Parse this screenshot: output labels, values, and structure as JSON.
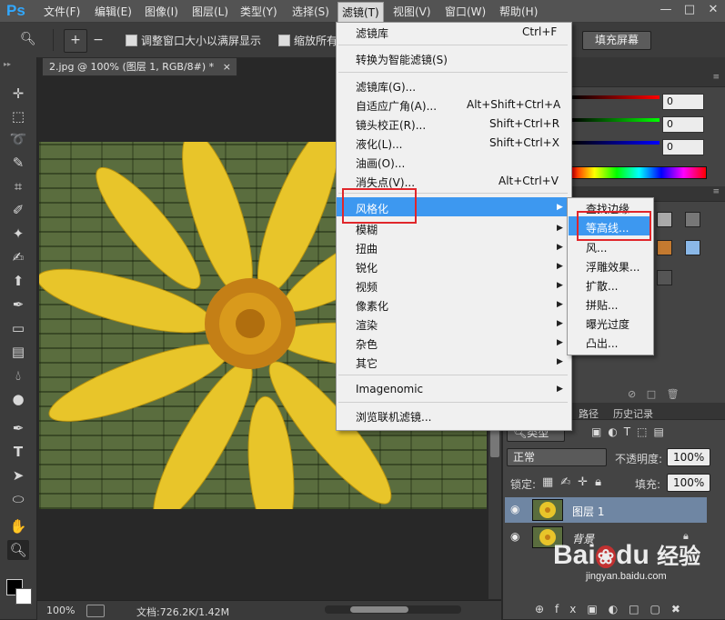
{
  "app": {
    "logo": "Ps"
  },
  "menubar": {
    "items": [
      "文件(F)",
      "编辑(E)",
      "图像(I)",
      "图层(L)",
      "类型(Y)",
      "选择(S)",
      "滤镜(T)",
      "视图(V)",
      "窗口(W)",
      "帮助(H)"
    ],
    "active_index": 6,
    "window_controls": [
      "—",
      "□",
      "✕"
    ]
  },
  "options_bar": {
    "checkbox1_label": "调整窗口大小以满屏显示",
    "checkbox2_label": "缩放所有",
    "fill_screen_label": "填充屏幕"
  },
  "document": {
    "tab_title": "2.jpg @ 100% (图层 1, RGB/8#) *",
    "tab_close": "×",
    "zoom": "100%",
    "doc_info": "文档:726.2K/1.42M"
  },
  "filter_menu": {
    "items": [
      {
        "label": "滤镜库",
        "shortcut": "Ctrl+F"
      },
      {
        "label": "转换为智能滤镜(S)",
        "shortcut": ""
      },
      {
        "label": "滤镜库(G)...",
        "shortcut": ""
      },
      {
        "label": "自适应广角(A)...",
        "shortcut": "Alt+Shift+Ctrl+A"
      },
      {
        "label": "镜头校正(R)...",
        "shortcut": "Shift+Ctrl+R"
      },
      {
        "label": "液化(L)...",
        "shortcut": "Shift+Ctrl+X"
      },
      {
        "label": "油画(O)...",
        "shortcut": ""
      },
      {
        "label": "消失点(V)...",
        "shortcut": "Alt+Ctrl+V"
      },
      {
        "label": "风格化",
        "shortcut": ""
      },
      {
        "label": "模糊",
        "shortcut": ""
      },
      {
        "label": "扭曲",
        "shortcut": ""
      },
      {
        "label": "锐化",
        "shortcut": ""
      },
      {
        "label": "视频",
        "shortcut": ""
      },
      {
        "label": "像素化",
        "shortcut": ""
      },
      {
        "label": "渲染",
        "shortcut": ""
      },
      {
        "label": "杂色",
        "shortcut": ""
      },
      {
        "label": "其它",
        "shortcut": ""
      },
      {
        "label": "Imagenomic",
        "shortcut": ""
      },
      {
        "label": "浏览联机滤镜...",
        "shortcut": ""
      }
    ],
    "highlighted_index": 8
  },
  "stylize_submenu": {
    "items": [
      "查找边缘",
      "等高线...",
      "风...",
      "浮雕效果...",
      "扩散...",
      "拼贴...",
      "曝光过度",
      "凸出..."
    ],
    "highlighted_index": 1
  },
  "color_panel": {
    "values": [
      "0",
      "0",
      "0"
    ]
  },
  "panel_tabs": [
    "路径",
    "历史记录"
  ],
  "layers_panel": {
    "kind_label": "类型",
    "blend_mode": "正常",
    "opacity_label": "不透明度:",
    "opacity_value": "100%",
    "lock_label": "锁定:",
    "fill_label": "填充:",
    "fill_value": "100%",
    "layers": [
      {
        "name": "图层 1",
        "selected": true
      },
      {
        "name": "背景",
        "selected": false,
        "locked": true
      }
    ]
  },
  "watermark": {
    "brand": "Bai",
    "brand2": "du",
    "suffix": "经验",
    "url": "jingyan.baidu.com"
  },
  "colors": {
    "accent": "#3d98f0",
    "highlight_box": "#e0262b",
    "ps_blue": "#31a8ff"
  }
}
